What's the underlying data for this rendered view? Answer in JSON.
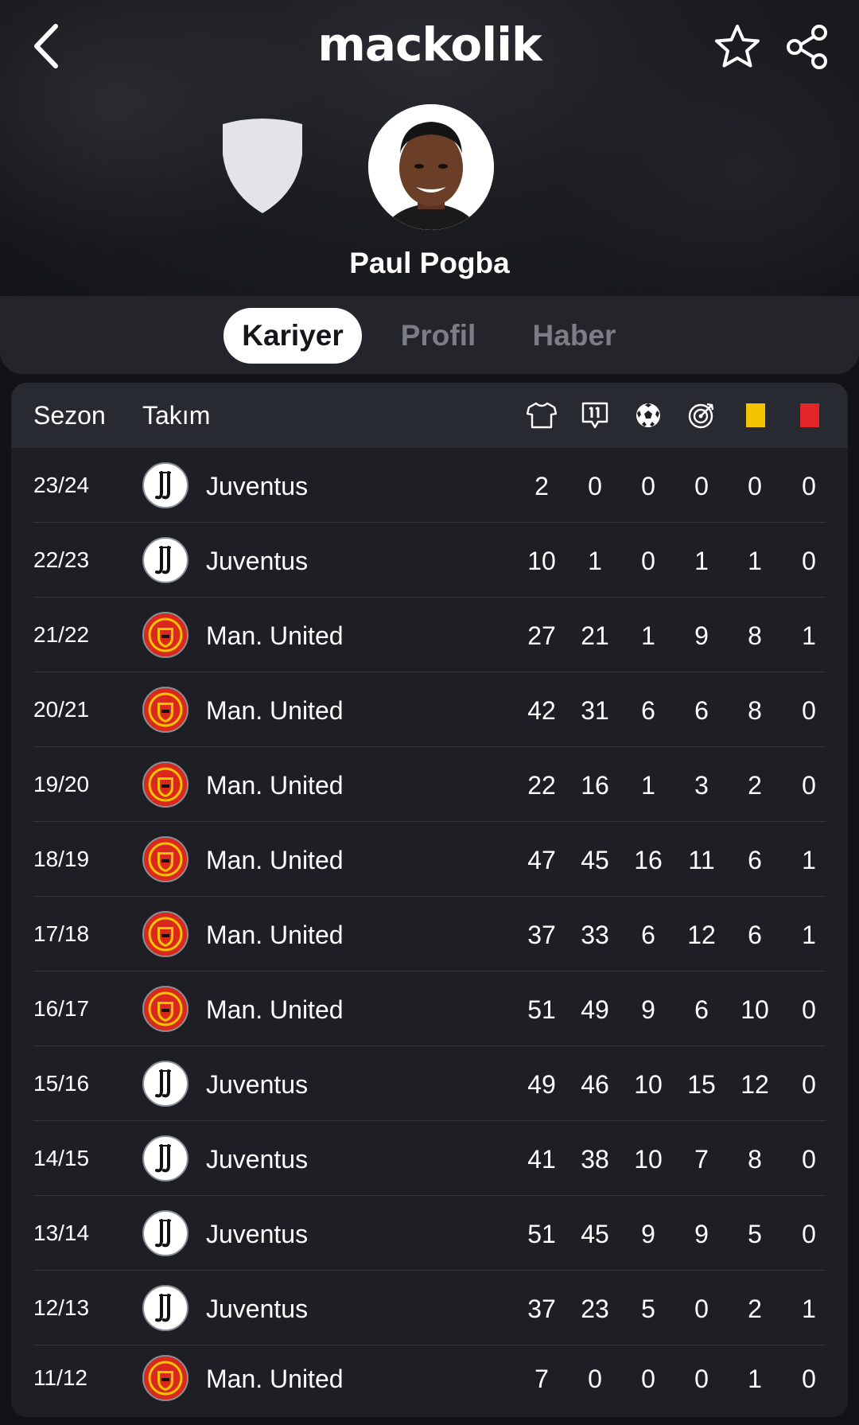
{
  "app": {
    "logo": "mackolik"
  },
  "player": {
    "name": "Paul Pogba"
  },
  "tabs": [
    {
      "label": "Kariyer",
      "active": true
    },
    {
      "label": "Profil",
      "active": false
    },
    {
      "label": "Haber",
      "active": false
    }
  ],
  "table": {
    "headers": {
      "season": "Sezon",
      "team": "Takım",
      "stat_icons": [
        "jersey-icon",
        "lineup-11-icon",
        "football-icon",
        "target-icon",
        "yellow-card-icon",
        "red-card-icon"
      ]
    },
    "colors": {
      "yellow_card": "#f5c400",
      "red_card": "#e2262a",
      "man_united": "#da291c"
    },
    "rows": [
      {
        "season": "23/24",
        "team": "Juventus",
        "club": "juventus",
        "stats": [
          "2",
          "0",
          "0",
          "0",
          "0",
          "0"
        ]
      },
      {
        "season": "22/23",
        "team": "Juventus",
        "club": "juventus",
        "stats": [
          "10",
          "1",
          "0",
          "1",
          "1",
          "0"
        ]
      },
      {
        "season": "21/22",
        "team": "Man. United",
        "club": "manutd",
        "stats": [
          "27",
          "21",
          "1",
          "9",
          "8",
          "1"
        ]
      },
      {
        "season": "20/21",
        "team": "Man. United",
        "club": "manutd",
        "stats": [
          "42",
          "31",
          "6",
          "6",
          "8",
          "0"
        ]
      },
      {
        "season": "19/20",
        "team": "Man. United",
        "club": "manutd",
        "stats": [
          "22",
          "16",
          "1",
          "3",
          "2",
          "0"
        ]
      },
      {
        "season": "18/19",
        "team": "Man. United",
        "club": "manutd",
        "stats": [
          "47",
          "45",
          "16",
          "11",
          "6",
          "1"
        ]
      },
      {
        "season": "17/18",
        "team": "Man. United",
        "club": "manutd",
        "stats": [
          "37",
          "33",
          "6",
          "12",
          "6",
          "1"
        ]
      },
      {
        "season": "16/17",
        "team": "Man. United",
        "club": "manutd",
        "stats": [
          "51",
          "49",
          "9",
          "6",
          "10",
          "0"
        ]
      },
      {
        "season": "15/16",
        "team": "Juventus",
        "club": "juventus",
        "stats": [
          "49",
          "46",
          "10",
          "15",
          "12",
          "0"
        ]
      },
      {
        "season": "14/15",
        "team": "Juventus",
        "club": "juventus",
        "stats": [
          "41",
          "38",
          "10",
          "7",
          "8",
          "0"
        ]
      },
      {
        "season": "13/14",
        "team": "Juventus",
        "club": "juventus",
        "stats": [
          "51",
          "45",
          "9",
          "9",
          "5",
          "0"
        ]
      },
      {
        "season": "12/13",
        "team": "Juventus",
        "club": "juventus",
        "stats": [
          "37",
          "23",
          "5",
          "0",
          "2",
          "1"
        ]
      },
      {
        "season": "11/12",
        "team": "Man. United",
        "club": "manutd",
        "stats": [
          "7",
          "0",
          "0",
          "0",
          "1",
          "0"
        ]
      }
    ]
  }
}
